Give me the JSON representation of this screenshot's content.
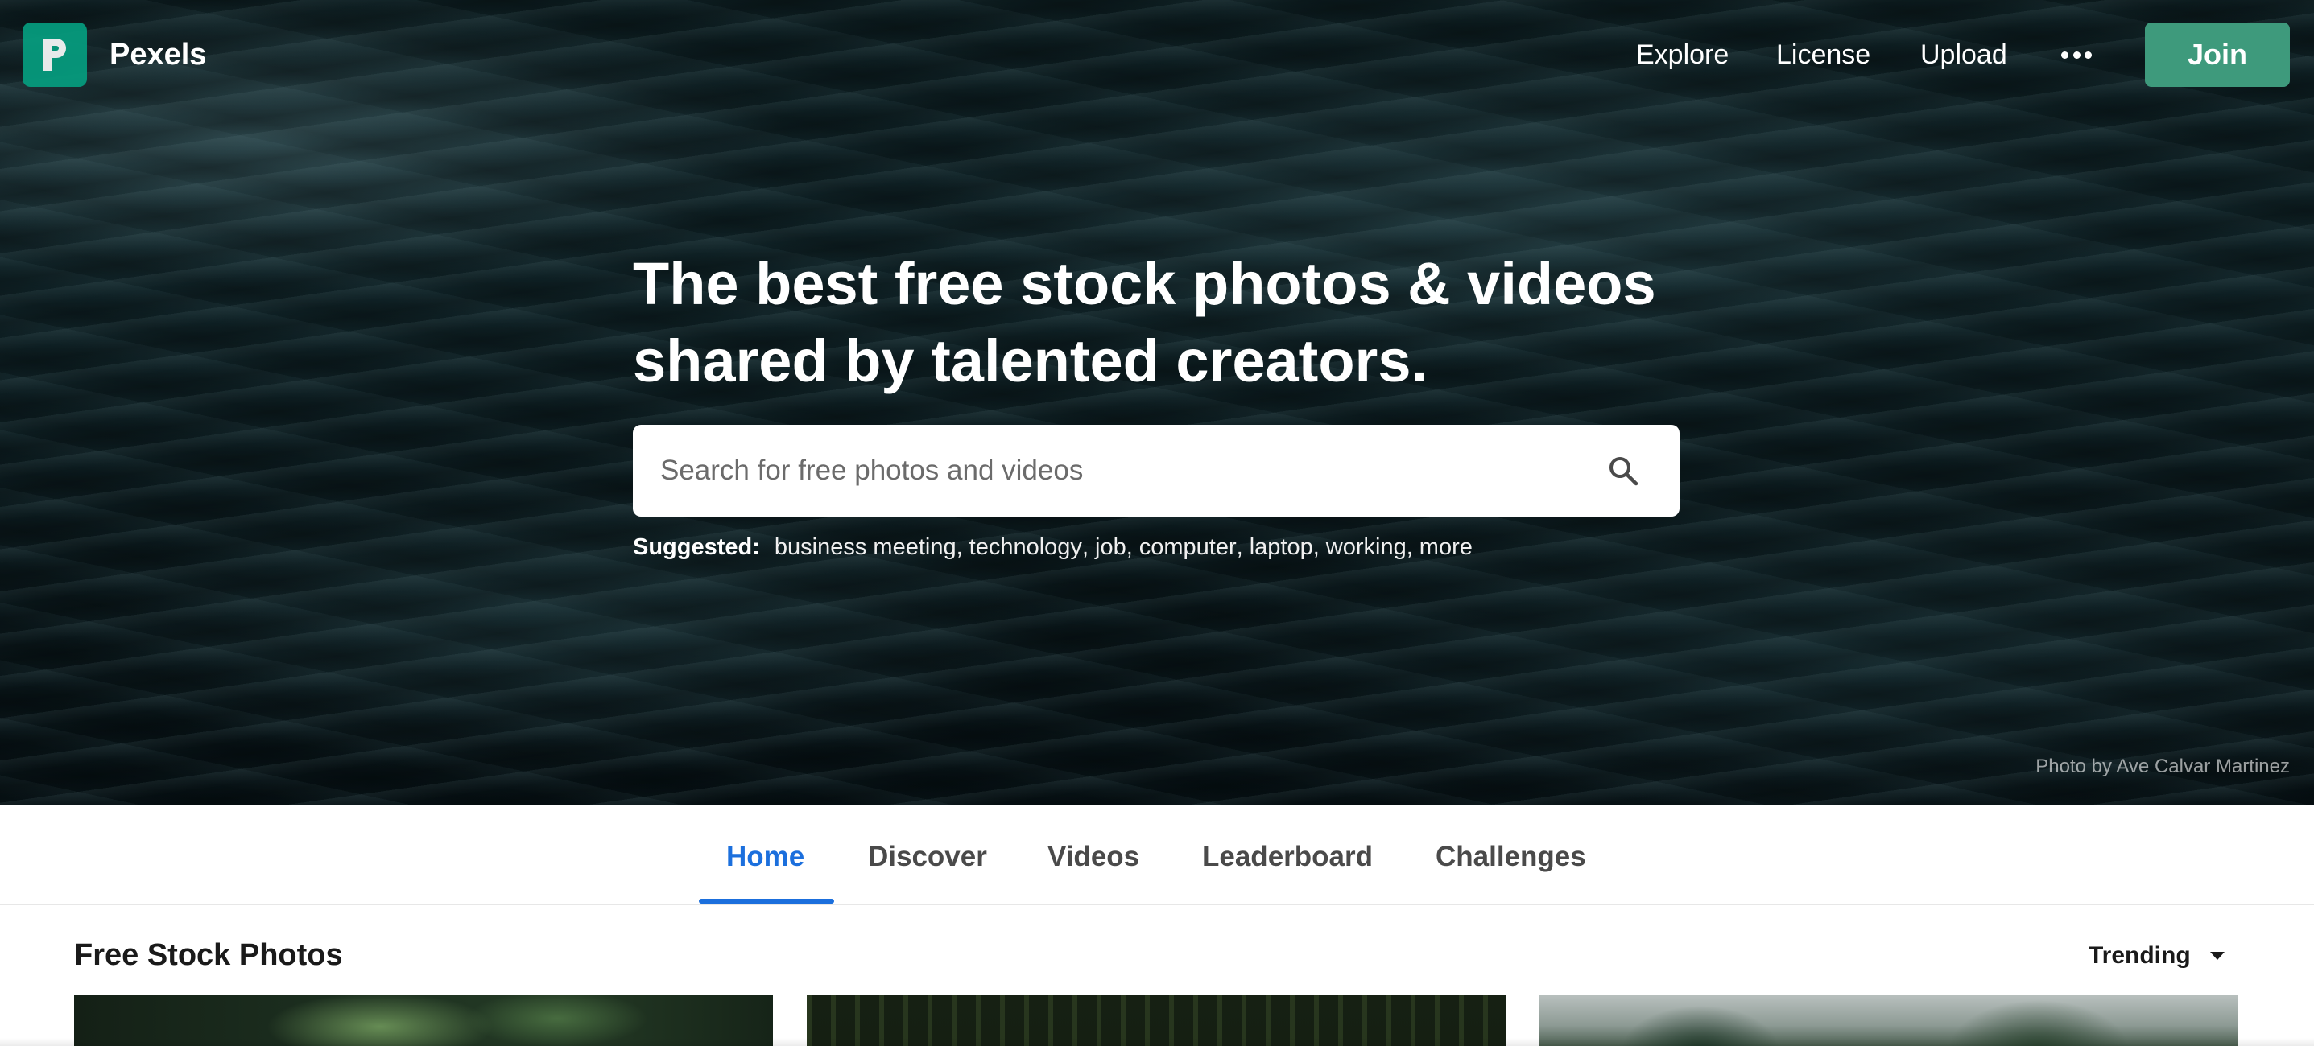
{
  "header": {
    "brand": "Pexels",
    "nav": {
      "explore": "Explore",
      "license": "License",
      "upload": "Upload",
      "more_icon": "ellipsis-icon"
    },
    "join_label": "Join",
    "logo_color": "#05a081",
    "join_color": "#3e9a7c"
  },
  "hero": {
    "headline_line1": "The best free stock photos & videos",
    "headline_line2": "shared by talented creators.",
    "search": {
      "placeholder": "Search for free photos and videos",
      "value": "",
      "icon": "search-icon"
    },
    "suggested": {
      "label": "Suggested:",
      "items": [
        "business meeting",
        "technology",
        "job",
        "computer",
        "laptop",
        "working",
        "more"
      ]
    },
    "credit": "Photo by Ave Calvar Martinez"
  },
  "tabs": {
    "items": [
      "Home",
      "Discover",
      "Videos",
      "Leaderboard",
      "Challenges"
    ],
    "active": "Home",
    "active_color": "#1b6fdd"
  },
  "content": {
    "section_title": "Free Stock Photos",
    "sort": {
      "selected": "Trending",
      "icon": "caret-down-icon"
    }
  }
}
